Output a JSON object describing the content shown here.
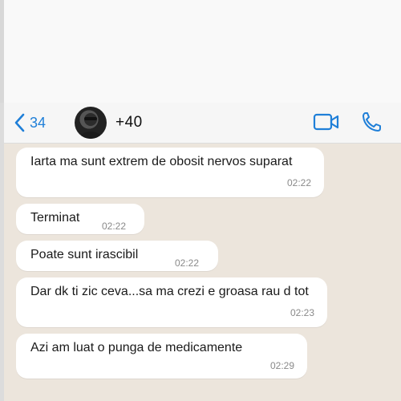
{
  "header": {
    "back_count": "34",
    "contact": "+40",
    "icons": {
      "back": "chevron-left-icon",
      "video": "video-camera-icon",
      "call": "phone-icon"
    },
    "accent_color": "#1f7fd8"
  },
  "messages": [
    {
      "text": "Iarta ma sunt extrem de obosit nervos suparat",
      "time": "02:22"
    },
    {
      "text": "Terminat",
      "time": "02:22"
    },
    {
      "text": "Poate sunt irascibil",
      "time": "02:22"
    },
    {
      "text": "Dar dk ti zic ceva...sa ma crezi e groasa rau d tot",
      "time": "02:23"
    },
    {
      "text": "Azi am luat o punga de medicamente",
      "time": "02:29"
    }
  ],
  "colors": {
    "chat_background": "#ece5dc",
    "bubble": "#ffffff"
  }
}
